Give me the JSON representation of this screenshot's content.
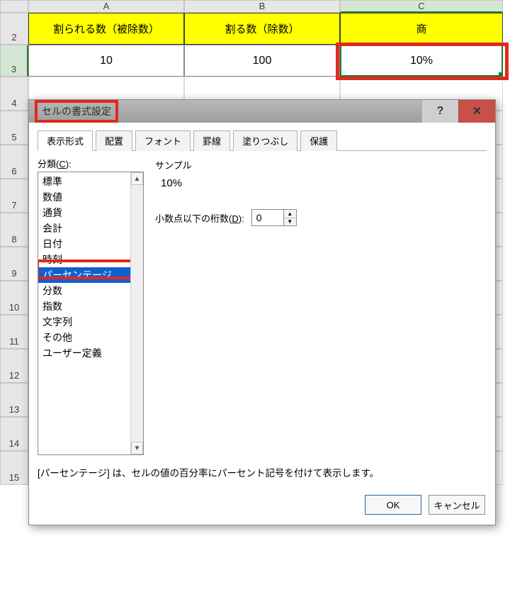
{
  "columns": {
    "A": "A",
    "B": "B",
    "C": "C"
  },
  "rows": {
    "r2": "2",
    "r3": "3",
    "r4": "4",
    "r5": "5",
    "r6": "6",
    "r7": "7",
    "r8": "8",
    "r9": "9",
    "r10": "10",
    "r11": "11",
    "r12": "12",
    "r13": "13",
    "r14": "14",
    "r15": "15"
  },
  "headers": {
    "A": "割られる数（被除数）",
    "B": "割る数（除数）",
    "C": "商"
  },
  "data": {
    "A3": "10",
    "B3": "100",
    "C3": "10%"
  },
  "dialog": {
    "title": "セルの書式設定",
    "help": "?",
    "close": "✕",
    "tabs": {
      "display": "表示形式",
      "align": "配置",
      "font": "フォント",
      "border": "罫線",
      "fill": "塗りつぶし",
      "protect": "保護"
    },
    "category_label_pre": "分類(",
    "category_label_u": "C",
    "category_label_post": "):",
    "categories": [
      "標準",
      "数値",
      "通貨",
      "会計",
      "日付",
      "時刻",
      "パーセンテージ",
      "分数",
      "指数",
      "文字列",
      "その他",
      "ユーザー定義"
    ],
    "selected_category_index": 6,
    "sample_label": "サンプル",
    "sample_value": "10%",
    "decimals_label_pre": "小数点以下の桁数(",
    "decimals_label_u": "D",
    "decimals_label_post": "):",
    "decimals_value": "0",
    "description": "[パーセンテージ] は、セルの値の百分率にパーセント記号を付けて表示します。",
    "ok": "OK",
    "cancel": "キャンセル"
  }
}
